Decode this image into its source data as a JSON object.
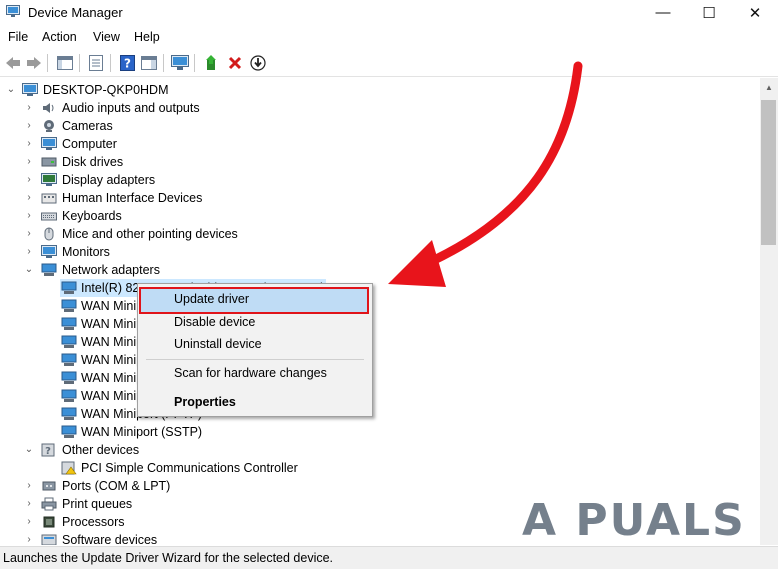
{
  "window": {
    "title": "Device Manager",
    "controls": {
      "minimize": "—",
      "maximize": "☐",
      "close": "✕"
    }
  },
  "menu": [
    "File",
    "Action",
    "View",
    "Help"
  ],
  "tree": {
    "root": "DESKTOP-QKP0HDM",
    "categories": [
      "Audio inputs and outputs",
      "Cameras",
      "Computer",
      "Disk drives",
      "Display adapters",
      "Human Interface Devices",
      "Keyboards",
      "Mice and other pointing devices",
      "Monitors",
      "Network adapters"
    ],
    "network_children": [
      "Intel(R) 82579LM Gigabit Network Connection",
      "WAN Minip",
      "WAN Minip",
      "WAN Minip",
      "WAN Minip",
      "WAN Minip",
      "WAN Minip",
      "WAN Miniport (PPTP)",
      "WAN Miniport (SSTP)"
    ],
    "other_devices": "Other devices",
    "other_children": [
      "PCI Simple Communications Controller"
    ],
    "after": [
      "Ports (COM & LPT)",
      "Print queues",
      "Processors",
      "Software devices"
    ]
  },
  "context_menu": {
    "update": "Update driver",
    "disable": "Disable device",
    "uninstall": "Uninstall device",
    "scan": "Scan for hardware changes",
    "properties": "Properties"
  },
  "status": "Launches the Update Driver Wizard for the selected device.",
  "watermark": "A  PUALS",
  "colors": {
    "highlight_border": "#e0141a",
    "arrow": "#e8141b",
    "selection": "#cce8ff"
  }
}
